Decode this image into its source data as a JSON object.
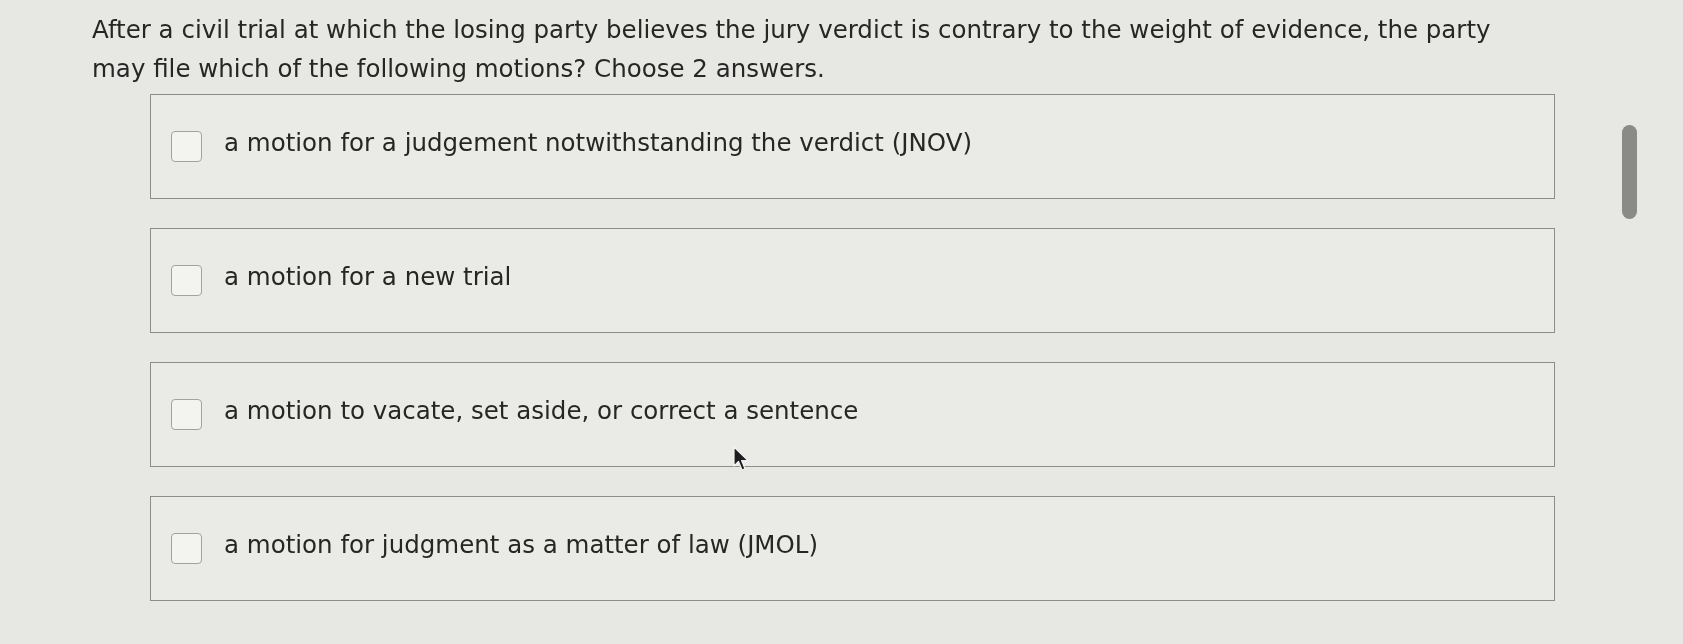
{
  "question": "After a civil trial at which the losing party believes the jury verdict is contrary to the weight of evidence, the party may file which of the following motions? Choose 2 answers.",
  "options": [
    {
      "label": "a motion for a judgement notwithstanding the verdict (JNOV)",
      "checked": false
    },
    {
      "label": "a motion for a new trial",
      "checked": false
    },
    {
      "label": "a motion to vacate, set aside, or correct a sentence",
      "checked": false
    },
    {
      "label": "a motion for judgment as a matter of law (JMOL)",
      "checked": false
    }
  ]
}
